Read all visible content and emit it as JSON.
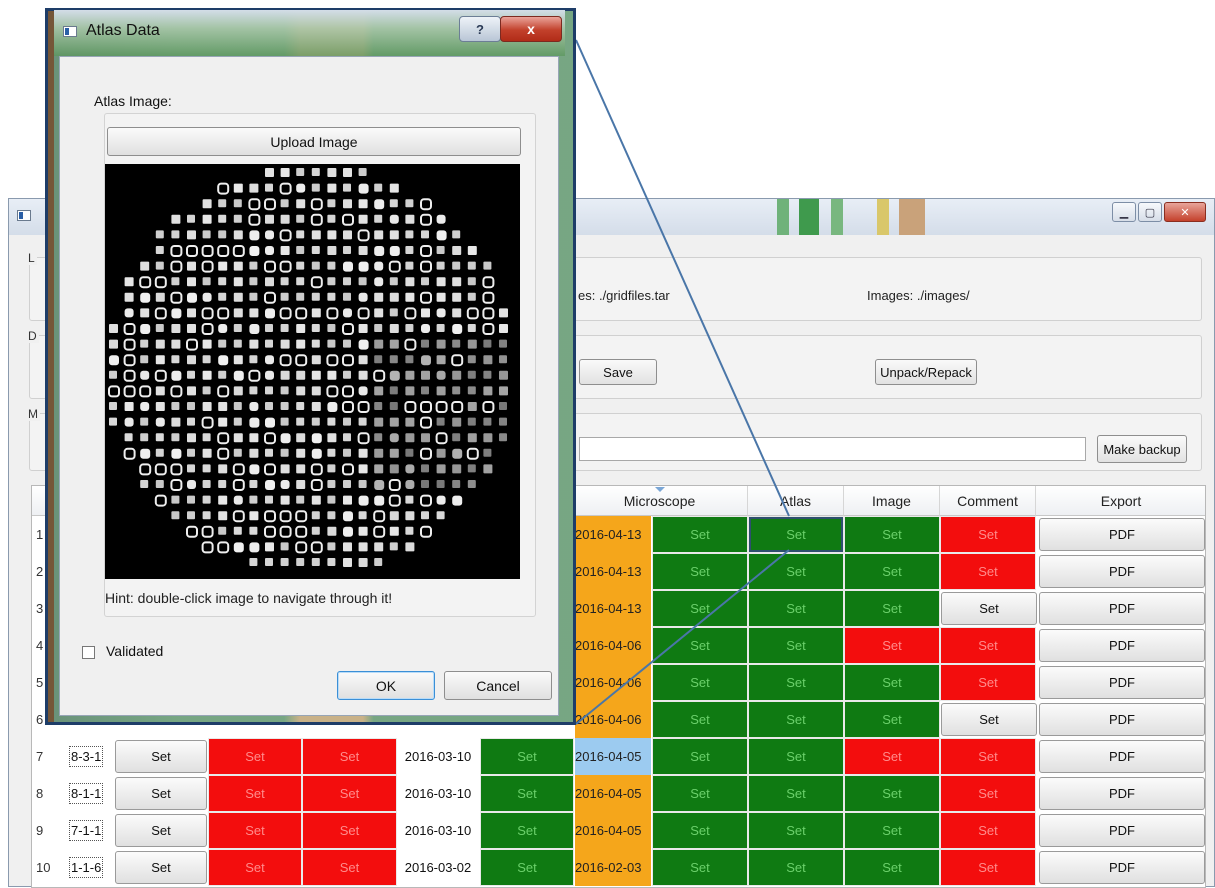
{
  "main_window": {
    "paths": {
      "gridfiles_text": "es: ./gridfiles.tar",
      "images_text": "Images: ./images/"
    },
    "group_letters": [
      "L",
      "D",
      "M"
    ],
    "buttons": {
      "save": "Save",
      "unpack_repack": "Unpack/Repack",
      "make_backup": "Make backup"
    },
    "table": {
      "visible_headers": [
        "Microscope",
        "Atlas",
        "Image",
        "Comment",
        "Export"
      ],
      "rows": [
        {
          "n": "1",
          "microscope_date": "2016-04-13",
          "microscope": "Set",
          "atlas": "Set",
          "image": "Set",
          "comment": "Set",
          "export": "PDF"
        },
        {
          "n": "2",
          "microscope_date": "2016-04-13",
          "microscope": "Set",
          "atlas": "Set",
          "image": "Set",
          "comment": "Set",
          "export": "PDF"
        },
        {
          "n": "3",
          "microscope_date": "2016-04-13",
          "microscope": "Set",
          "atlas": "Set",
          "image": "Set",
          "comment": "Set",
          "export": "PDF"
        },
        {
          "n": "4",
          "microscope_date": "2016-04-06",
          "microscope": "Set",
          "atlas": "Set",
          "image": "Set",
          "comment": "Set",
          "export": "PDF"
        },
        {
          "n": "5",
          "microscope_date": "2016-04-06",
          "microscope": "Set",
          "atlas": "Set",
          "image": "Set",
          "comment": "Set",
          "export": "PDF"
        },
        {
          "n": "6",
          "microscope_date": "2016-04-06",
          "microscope": "Set",
          "atlas": "Set",
          "image": "Set",
          "comment": "Set",
          "export": "PDF"
        },
        {
          "n": "7",
          "sample": "8-3-1",
          "c1": "Set",
          "c2": "Set",
          "c3": "Set",
          "date1": "2016-03-10",
          "c5": "Set",
          "microscope_date": "2016-04-05",
          "microscope": "Set",
          "atlas": "Set",
          "image": "Set",
          "comment": "Set",
          "export": "PDF"
        },
        {
          "n": "8",
          "sample": "8-1-1",
          "c1": "Set",
          "c2": "Set",
          "c3": "Set",
          "date1": "2016-03-10",
          "c5": "Set",
          "microscope_date": "2016-04-05",
          "microscope": "Set",
          "atlas": "Set",
          "image": "Set",
          "comment": "Set",
          "export": "PDF"
        },
        {
          "n": "9",
          "sample": "7-1-1",
          "c1": "Set",
          "c2": "Set",
          "c3": "Set",
          "date1": "2016-03-10",
          "c5": "Set",
          "microscope_date": "2016-04-05",
          "microscope": "Set",
          "atlas": "Set",
          "image": "Set",
          "comment": "Set",
          "export": "PDF"
        },
        {
          "n": "10",
          "sample": "1-1-6",
          "c1": "Set",
          "c2": "Set",
          "c3": "Set",
          "date1": "2016-03-02",
          "c5": "Set",
          "microscope_date": "2016-02-03",
          "microscope": "Set",
          "atlas": "Set",
          "image": "Set",
          "comment": "Set",
          "export": "PDF"
        }
      ]
    }
  },
  "dialog": {
    "title": "Atlas Data",
    "help_glyph": "?",
    "close_glyph": "x",
    "atlas_image_label": "Atlas Image:",
    "upload_button": "Upload Image",
    "hint": "Hint: double-click image to navigate through it!",
    "validated_label": "Validated",
    "ok": "OK",
    "cancel": "Cancel"
  },
  "colors": {
    "set_green": "#0f7a12",
    "set_red": "#f30d0d",
    "date_orange": "#f5a61b",
    "date_blue": "#9ccbf0",
    "callout_line": "#4a76a8"
  }
}
